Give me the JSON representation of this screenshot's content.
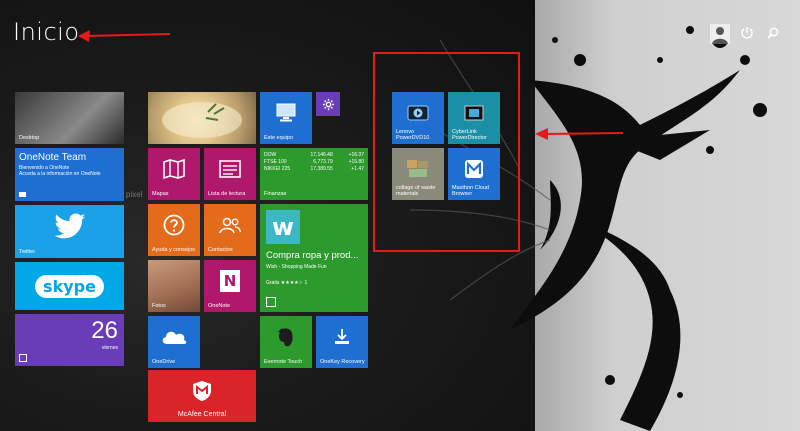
{
  "start": {
    "title": "Inicio"
  },
  "tiles": {
    "desktop": "Desktop",
    "onenote": {
      "title": "OneNote Team",
      "lines": [
        "Bienvenido a OneNote",
        "Acceda a la información en OneNote"
      ]
    },
    "twitter": "Twitter",
    "skype": "skype",
    "calendar": {
      "day": "26",
      "weekday": "viernes"
    },
    "mapas": "Mapas",
    "lista_lectura": "Lista de lectura",
    "ayuda": "Ayuda y consejos",
    "contactos": "Contactos",
    "fotos": "Fotos",
    "onenote_app": "OneNote",
    "onedrive": "OneDrive",
    "mcafee": "McAfee Central",
    "este_equipo": "Este equipo",
    "finanzas": {
      "label": "Finanzas",
      "rows": [
        [
          "DOW",
          "17,146.48",
          "+16.37"
        ],
        [
          "FTSE 100",
          "6,773.79",
          "+15.80"
        ],
        [
          "NIKKEI 225",
          "17,389.55",
          "+1.47"
        ]
      ]
    },
    "store": {
      "title": "Compra ropa y prod...",
      "sub": "Wish - Shopping Made Fun",
      "rating": "Gratis ★★★★☆ 1",
      "logo": "w"
    },
    "evernote": "Evernote Touch",
    "onekey": "OneKey Recovery",
    "lenovo_dvd": "Lenovo PowerDVD10",
    "cyberlink": "CyberLink PowerDirector",
    "collage": "collage of waste materials",
    "maxthon": "Maxthon Cloud Browser"
  },
  "misc": {
    "pixel_text": "pixel"
  },
  "colors": {
    "blue": "#1e6fd1",
    "purple": "#6a3db8",
    "magenta": "#b0186c",
    "orange": "#e46a1c",
    "green": "#2c9a2c",
    "red_annotation": "#e31b1b"
  }
}
